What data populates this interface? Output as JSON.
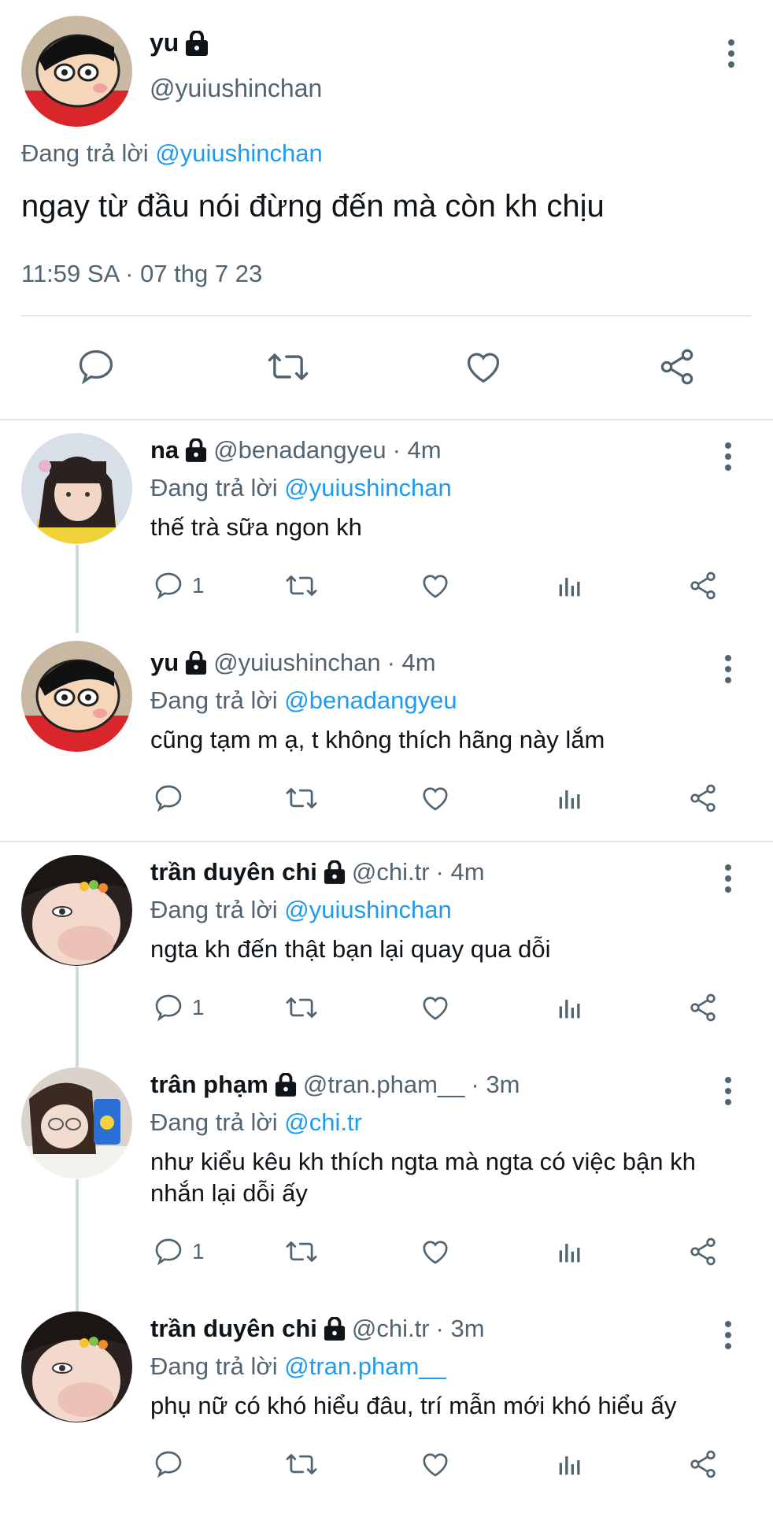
{
  "main_tweet": {
    "name": "yu",
    "handle": "@yuiushinchan",
    "reply_prefix": "Đang trả lời",
    "reply_to": "@yuiushinchan",
    "text": "ngay từ đầu nói đừng đến mà còn kh chịu",
    "timestamp": "11:59 SA · 07 thg 7 23"
  },
  "replies": [
    {
      "name": "na",
      "handle": "@benadangyeu",
      "time": "· 4m",
      "reply_prefix": "Đang trả lời",
      "reply_to": "@yuiushinchan",
      "text": "thế trà sữa ngon kh",
      "reply_count": "1"
    },
    {
      "name": "yu",
      "handle": "@yuiushinchan",
      "time": "· 4m",
      "reply_prefix": "Đang trả lời",
      "reply_to": "@benadangyeu",
      "text": "cũng tạm m ạ, t không thích hãng này lắm",
      "reply_count": ""
    },
    {
      "name": "trần duyên chi",
      "handle": "@chi.tr",
      "time": "· 4m",
      "reply_prefix": "Đang trả lời",
      "reply_to": "@yuiushinchan",
      "text": "ngta kh đến thật bạn lại quay qua dỗi",
      "reply_count": "1"
    },
    {
      "name": "trân phạm",
      "handle": "@tran.pham__",
      "time": "· 3m",
      "reply_prefix": "Đang trả lời",
      "reply_to": "@chi.tr",
      "text": "như kiểu kêu kh thích ngta mà ngta có việc bận kh nhắn lại dỗi ấy",
      "reply_count": "1"
    },
    {
      "name": "trần duyên chi",
      "handle": "@chi.tr",
      "time": "· 3m",
      "reply_prefix": "Đang trả lời",
      "reply_to": "@tran.pham__",
      "text": "phụ nữ có khó hiểu đâu, trí mẫn mới khó hiểu ấy",
      "reply_count": ""
    }
  ],
  "icons": {
    "reply": "comment-icon",
    "retweet": "retweet-icon",
    "like": "heart-icon",
    "views": "analytics-icon",
    "share": "share-icon",
    "lock": "lock-icon",
    "more": "more-options-icon"
  },
  "colors": {
    "link": "#1d9bf0",
    "secondary_text": "#536471",
    "primary_text": "#0f1419",
    "thread_line": "#cfd9de"
  }
}
